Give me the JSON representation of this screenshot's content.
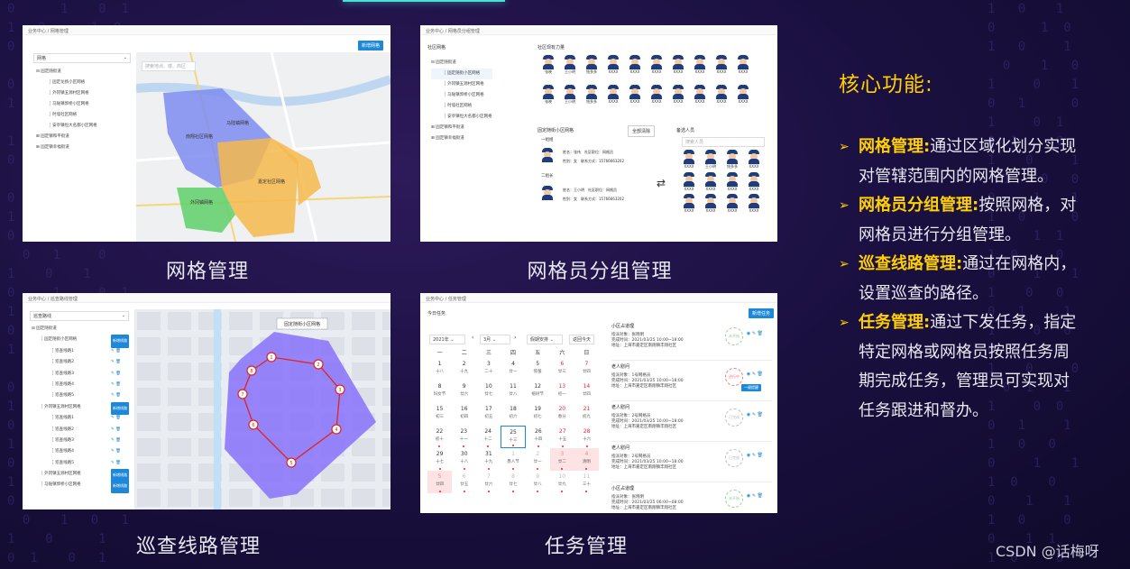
{
  "panels": {
    "grid": {
      "breadcrumb": "业务中心 / 网格管理",
      "add_button": "新增网格",
      "tree_select": "网格",
      "search_placeholder": "搜索地点、楼、商区",
      "tree": [
        "固定随街道",
        "固定龙扬小区网格",
        "外冈镇五源村区网格",
        "马陆镇郭桥小区网格",
        "时墙社区网格",
        "安亭镇恒大名都小区网格",
        "固定镇和平街道",
        "固定镇幸福街道"
      ],
      "map_labels": [
        "南翔社区网格",
        "马陆镇网格",
        "嘉定社区网格",
        "外冈镇网格",
        "南翔"
      ],
      "caption": "网格管理"
    },
    "group": {
      "breadcrumb": "业务中心 / 网格员分组管理",
      "tree_title": "社区网格",
      "power_title": "社区现有力量",
      "tree": [
        "固定随街道",
        "固定随街小区网格",
        "外冈镇五源村区网格",
        "马陆镇郭桥小区网格",
        "时墙社区网格",
        "安亭镇恒大名都小区网格",
        "固定镇和平街道",
        "固定镇幸福街道"
      ],
      "names_row1": [
        "张晓",
        "王小明",
        "钱多多",
        "XXXX",
        "XXXX",
        "XXXX",
        "XXXX",
        "XXXX",
        "XXXX",
        "XXXX"
      ],
      "names_row2": [
        "张晓",
        "王小明",
        "钱多多",
        "XXXX",
        "XXXX",
        "XXXX",
        "XXXX",
        "XXXX",
        "XXXX",
        "XXXX"
      ],
      "sub_title": "固定随街小区网格",
      "clear": "全部清除",
      "group1": "一组组",
      "group2": "二组长",
      "m1": [
        "姓名：张伟　社区职位：网格员",
        "性别：女　联系方式：15766663202"
      ],
      "m2": [
        "姓名：王小明　社区职位：网格员",
        "性别：女　联系方式：15766663202"
      ],
      "pool_title": "备选人员",
      "pool_search": "搜索人员",
      "pool_names": [
        "XXXX",
        "王小明",
        "钱多多",
        "XXXX",
        "XXXX",
        "XXXX",
        "XXXX",
        "XXXX",
        "XXXX",
        "XXXX",
        "XXXX",
        "XXXX"
      ],
      "caption": "网格员分组管理"
    },
    "route": {
      "breadcrumb": "业务中心 / 巡查路线管理",
      "tree_select": "巡查路线",
      "tree": [
        "固定随街道",
        "固定随街小区网格",
        "巡查线路1",
        "巡查线路2",
        "巡查线路3",
        "巡查线路4",
        "巡查线路5",
        "外冈镇五源村区网格",
        "巡查线路1",
        "巡查线路2",
        "巡查线路3",
        "巡查线路4",
        "巡查线路5",
        "外冈镇五源村区网格",
        "马陆镇郭桥小区网格"
      ],
      "add_route": "新增线路",
      "tooltip": "固定随街小区网格",
      "points": [
        "1",
        "2",
        "3",
        "4",
        "5",
        "6",
        "7",
        "8"
      ],
      "caption": "巡查线路管理"
    },
    "task": {
      "breadcrumb": "业务中心 / 任务管理",
      "today": "今日任务",
      "new_task": "新增任务",
      "year": "2021年",
      "month": "3月",
      "arrange": "假期安排",
      "back_today": "返回今天",
      "weekdays": [
        "一",
        "二",
        "三",
        "四",
        "五",
        "六",
        "日"
      ],
      "rows": [
        [
          [
            "1",
            "十八"
          ],
          [
            "2",
            "十九"
          ],
          [
            "3",
            "二十"
          ],
          [
            "4",
            "廿一"
          ],
          [
            "5",
            "惊蛰"
          ],
          [
            "6",
            "廿三"
          ],
          [
            "7",
            "廿四"
          ]
        ],
        [
          [
            "8",
            "妇女节"
          ],
          [
            "9",
            "廿六"
          ],
          [
            "10",
            "廿七"
          ],
          [
            "11",
            "廿八"
          ],
          [
            "12",
            "植树节"
          ],
          [
            "13",
            "初一"
          ],
          [
            "14",
            "廿四"
          ]
        ],
        [
          [
            "15",
            "初三"
          ],
          [
            "16",
            "初四"
          ],
          [
            "17",
            "初五"
          ],
          [
            "18",
            "初六"
          ],
          [
            "19",
            "初七"
          ],
          [
            "20",
            "春分"
          ],
          [
            "21",
            "初九"
          ]
        ],
        [
          [
            "22",
            "初十"
          ],
          [
            "23",
            "十一"
          ],
          [
            "24",
            "十二"
          ],
          [
            "25",
            "十三"
          ],
          [
            "26",
            "十四"
          ],
          [
            "27",
            "十五"
          ],
          [
            "28",
            "十六"
          ]
        ],
        [
          [
            "29",
            "十七"
          ],
          [
            "30",
            "十八"
          ],
          [
            "31",
            "十九"
          ],
          [
            "1",
            "愚人节"
          ],
          [
            "2",
            "廿一"
          ],
          [
            "3",
            "廿二"
          ],
          [
            "4",
            "清明"
          ]
        ],
        [
          [
            "5",
            "廿四"
          ],
          [
            "6",
            "廿五"
          ],
          [
            "7",
            "廿六"
          ],
          [
            "8",
            "廿七"
          ],
          [
            "9",
            "廿八"
          ],
          [
            "10",
            "廿九"
          ],
          [
            "11",
            "三十"
          ]
        ]
      ],
      "tasks": [
        {
          "title": "小区占道理",
          "l1": "指派对象：张晓明",
          "l2": "完成时间：2021/03/25  10:00~18:00",
          "l3": "地址：上海市嘉定区南翔镇丰翔社区",
          "stamp": "未开始"
        },
        {
          "title": "老人慰问",
          "l1": "指派对象：1号网格员",
          "l2": "完成时间：2021/03/25  10:00~18:00",
          "l3": "地址：上海市嘉定区南翔镇丰翔社区",
          "stamp": "进行中",
          "btn": "一键提醒"
        },
        {
          "title": "老人慰问",
          "l1": "指派对象：2号网格员",
          "l2": "完成时间：2021/03/25  10:00~18:00",
          "l3": "地址：上海市嘉定区南翔镇丰翔社区",
          "stamp": "已完成"
        },
        {
          "title": "老人慰问",
          "l1": "指派对象：2号网格员",
          "l2": "完成时间：2021/03/25  10:00~18:00",
          "l3": "地址：上海市嘉定区南翔镇丰翔社区",
          "stamp": "已完成"
        },
        {
          "title": "小区占道理",
          "l1": "指派对象：张晓明",
          "l2": "完成时间：2021/03/25  06:00~08:00",
          "l3": "地址：上海市嘉定区南翔镇丰翔社区",
          "stamp": "未开始"
        }
      ],
      "caption": "任务管理"
    }
  },
  "core_title": "核心功能:",
  "features": [
    {
      "key": "网格管理:",
      "text": "通过区域化划分实现对管辖范围内的网格管理。"
    },
    {
      "key": "网格员分组管理:",
      "text": "按照网格，对网格员进行分组管理。"
    },
    {
      "key": "巡查线路管理:",
      "text": "通过在网格内，设置巡查的路径。"
    },
    {
      "key": "任务管理:",
      "text": "通过下发任务，指定特定网格或网格员按照任务周期完成任务，管理员可实现对任务跟进和督办。"
    }
  ],
  "watermark": "CSDN @话梅呀",
  "colors": {
    "accent": "#ffd000",
    "blue": "#1e88d8",
    "purple": "#7b61ff"
  }
}
